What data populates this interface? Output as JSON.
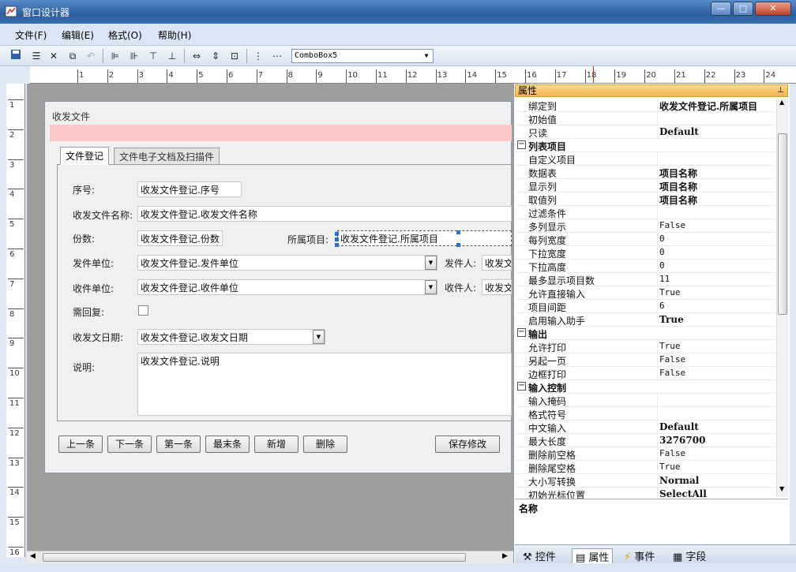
{
  "window": {
    "title": "窗口设计器",
    "min": "—",
    "max": "□",
    "close": "✕"
  },
  "menu": [
    "文件(F)",
    "编辑(E)",
    "格式(O)",
    "帮助(H)"
  ],
  "toolbar": {
    "combo_value": "ComboBox5"
  },
  "ruler": {
    "h": [
      "1",
      "2",
      "3",
      "4",
      "5",
      "6",
      "7",
      "8",
      "9",
      "10",
      "11",
      "12",
      "13",
      "14",
      "15",
      "16",
      "17",
      "18",
      "19",
      "20",
      "21",
      "22",
      "23",
      "24"
    ],
    "v": [
      "1",
      "2",
      "3",
      "4",
      "5",
      "6",
      "7",
      "8",
      "9",
      "10",
      "11",
      "12",
      "13",
      "14",
      "15",
      "16"
    ]
  },
  "form": {
    "title": "收发文件",
    "tabs": [
      "文件登记",
      "文件电子文档及扫描件"
    ],
    "fields": {
      "seq_label": "序号:",
      "seq_value": "收发文件登记.序号",
      "name_label": "收发文件名称:",
      "name_value": "收发文件登记.收发文件名称",
      "copies_label": "份数:",
      "copies_value": "收发文件登记.份数",
      "project_label": "所属项目:",
      "project_value": "收发文件登记.所属项目",
      "sender_unit_label": "发件单位:",
      "sender_unit_value": "收发文件登记.发件单位",
      "sender_label": "发件人:",
      "sender_value": "收发文",
      "recv_unit_label": "收件单位:",
      "recv_unit_value": "收发文件登记.收件单位",
      "recv_label": "收件人:",
      "recv_value": "收发文",
      "reply_label": "需回复:",
      "date_label": "收发文日期:",
      "date_value": "收发文件登记.收发文日期",
      "note_label": "说明:",
      "note_value": "收发文件登记.说明"
    },
    "buttons": [
      "上一条",
      "下一条",
      "第一条",
      "最末条",
      "新增",
      "删除",
      "保存修改"
    ]
  },
  "props": {
    "header": "属性",
    "rows": [
      {
        "k": "绑定到",
        "v": "收发文件登记.所属项目",
        "b": true
      },
      {
        "k": "初始值",
        "v": ""
      },
      {
        "k": "只读",
        "v": "Default",
        "b": true
      },
      {
        "k": "列表项目",
        "v": "",
        "cat": true
      },
      {
        "k": "自定义项目",
        "v": ""
      },
      {
        "k": "数据表",
        "v": "项目名称",
        "b": true
      },
      {
        "k": "显示列",
        "v": "项目名称",
        "b": true
      },
      {
        "k": "取值列",
        "v": "项目名称",
        "b": true
      },
      {
        "k": "过滤条件",
        "v": ""
      },
      {
        "k": "多列显示",
        "v": "False"
      },
      {
        "k": "每列宽度",
        "v": "0"
      },
      {
        "k": "下拉宽度",
        "v": "0"
      },
      {
        "k": "下拉高度",
        "v": "0"
      },
      {
        "k": "最多显示项目数",
        "v": "11"
      },
      {
        "k": "允许直接输入",
        "v": "True"
      },
      {
        "k": "项目间距",
        "v": "6"
      },
      {
        "k": "启用输入助手",
        "v": "True",
        "b": true
      },
      {
        "k": "输出",
        "v": "",
        "cat": true
      },
      {
        "k": "允许打印",
        "v": "True"
      },
      {
        "k": "另起一页",
        "v": "False"
      },
      {
        "k": "边框打印",
        "v": "False"
      },
      {
        "k": "输入控制",
        "v": "",
        "cat": true
      },
      {
        "k": "输入掩码",
        "v": ""
      },
      {
        "k": "格式符号",
        "v": ""
      },
      {
        "k": "中文输入",
        "v": "Default",
        "b": true
      },
      {
        "k": "最大长度",
        "v": "3276700",
        "b": true
      },
      {
        "k": "删除前空格",
        "v": "False"
      },
      {
        "k": "删除尾空格",
        "v": "True"
      },
      {
        "k": "大小写转换",
        "v": "Normal",
        "b": true
      },
      {
        "k": "初始光标位置",
        "v": "SelectAll",
        "b": true
      }
    ],
    "desc_title": "名称"
  },
  "bottom_tabs": [
    "控件",
    "属性",
    "事件",
    "字段"
  ]
}
